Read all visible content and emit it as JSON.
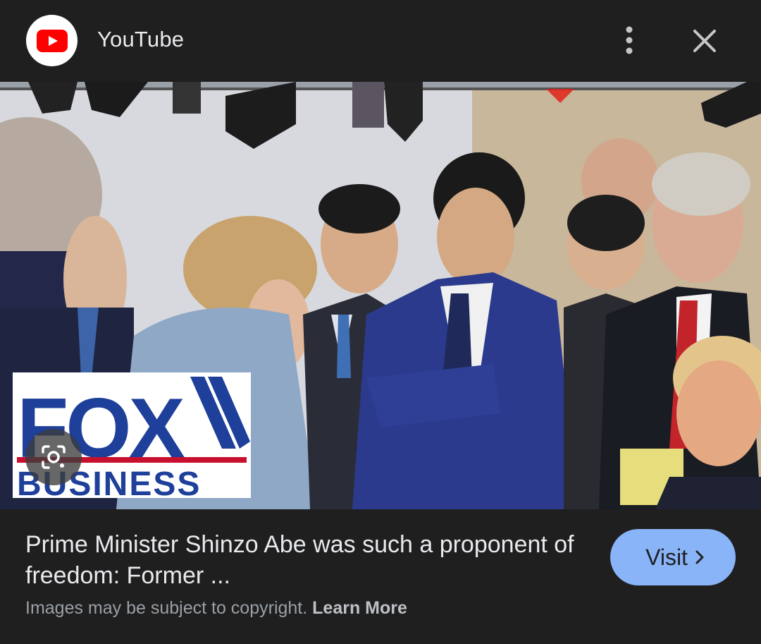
{
  "header": {
    "source_name": "YouTube",
    "logo_icon": "youtube-play-icon",
    "more_icon": "more-vert-icon",
    "close_icon": "close-icon"
  },
  "image": {
    "watermark_line1": "FOX",
    "watermark_line2": "BUSINESS",
    "lens_icon": "lens-camera-icon"
  },
  "result": {
    "caption": "Prime Minister Shinzo Abe was such a proponent of freedom: Former ...",
    "copyright_text": "Images may be subject to copyright.",
    "learn_more": "Learn More",
    "visit_label": "Visit"
  },
  "colors": {
    "background": "#1f1f1f",
    "visit_button": "#8ab4f8",
    "youtube_red": "#ff0000",
    "fox_blue": "#1e3f9a"
  }
}
